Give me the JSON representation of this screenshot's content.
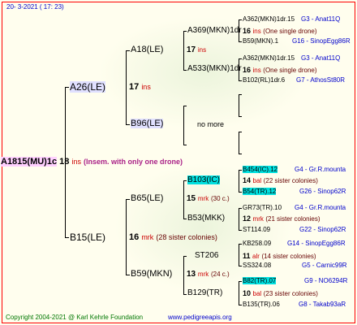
{
  "header": {
    "date": "20-  3-2021 ( 17: 23)"
  },
  "root": {
    "name": "A1815(MU)1c",
    "num": "18",
    "suffix": "ins",
    "note": "(Insem. with only one drone)"
  },
  "gen1": [
    {
      "name": "A26(LE)",
      "num": "17",
      "suffix": "ins"
    },
    {
      "name": "B15(LE)",
      "num": "16",
      "suffix": "mrk",
      "note": "(28 sister colonies)"
    }
  ],
  "gen2": [
    {
      "name": "A18(LE)",
      "num": "17",
      "suffix": "ins"
    },
    {
      "name": "B96(LE)",
      "note": "no more"
    },
    {
      "name": "B65(LE)",
      "num": "15",
      "suffix": "mrk",
      "note": "(30 c.)"
    },
    {
      "name": "B59(MKN)",
      "num": "13",
      "suffix": "mrk",
      "note": "(24 c.)"
    }
  ],
  "gen3": [
    {
      "name": "A369(MKN)1dr",
      "num": "16",
      "suffix": "ins",
      "note": "(One single drone)"
    },
    {
      "name": "A533(MKN)1dr",
      "num": "16",
      "suffix": "ins",
      "note": "(One single drone)"
    },
    {
      "name": "B103(IC)",
      "num": "14",
      "suffix": "bal",
      "note": "(22 sister colonies)"
    },
    {
      "name": "B53(MKK)",
      "num": "12",
      "suffix": "mrk",
      "note": "(21 sister colonies)"
    },
    {
      "name": "ST206",
      "num": "11",
      "suffix": "alr",
      "note": "(14 sister colonies)"
    },
    {
      "name": "B129(TR)",
      "num": "10",
      "suffix": "bal",
      "note": "(23 sister colonies)"
    }
  ],
  "gen4": [
    {
      "name": "A362(MKN)1dr.15",
      "code": "G3 - Anat11Q"
    },
    {
      "name": "B59(MKN).1",
      "code": "G16 - SinopEgg86R"
    },
    {
      "name": "A362(MKN)1dr.15",
      "code": "G3 - Anat11Q"
    },
    {
      "name": "B102(RL)1dr.6",
      "code": "G7 - AthosSt80R"
    },
    {
      "name": "B454(IC).12",
      "code": "G4 - Gr.R.mounta"
    },
    {
      "name": "B54(TR).12",
      "code": "G26 - Sinop62R"
    },
    {
      "name": "GR73(TR).10",
      "code": "G4 - Gr.R.mounta"
    },
    {
      "name": "ST114.09",
      "code": "G22 - Sinop62R"
    },
    {
      "name": "KB258.09",
      "code": "G14 - SinopEgg86R"
    },
    {
      "name": "SS324.08",
      "code": "G5 - Carnic99R"
    },
    {
      "name": "B82(TR).07",
      "code": "G9 - NO6294R"
    },
    {
      "name": "B135(TR).06",
      "code": "G8 - Takab93aR"
    }
  ],
  "footer": {
    "copyright": "Copyright 2004-2021 @ Karl Kehrle Foundation",
    "url": "www.pedigreeapis.org"
  },
  "colors": {
    "frame": "#ff0000",
    "background": "#fffeee",
    "highlight": "#00e0e0",
    "root_bg": "#ffd0ff",
    "name_bg": "#e0e0ff"
  }
}
